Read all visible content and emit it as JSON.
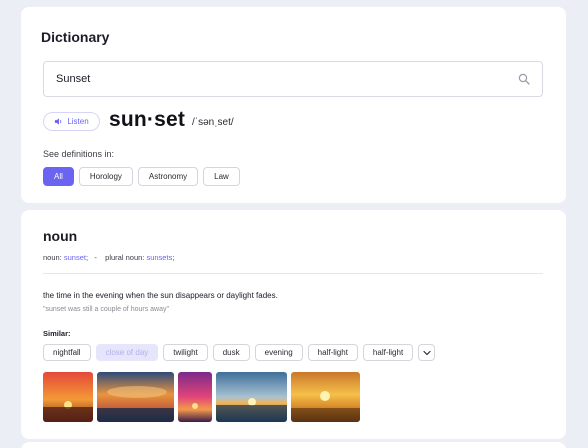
{
  "app": {
    "title": "Dictionary"
  },
  "search": {
    "value": "Sunset"
  },
  "entry": {
    "listen_label": "Listen",
    "headword": "sun·set",
    "phonetic": "/ˈsənˌset/"
  },
  "definitions_in": {
    "label": "See definitions in:",
    "options": [
      "All",
      "Horology",
      "Astronomy",
      "Law"
    ],
    "selected": "All"
  },
  "noun": {
    "part_of_speech": "noun",
    "form1_label": "noun:",
    "form1_word": "sunset",
    "separator": ";   -   ",
    "form2_label": "plural noun:",
    "form2_word": "sunsets",
    "trailing": ";",
    "definition": "the time in the evening when the sun disappears or daylight fades.",
    "example": "\"sunset was still a couple of hours away\"",
    "similar_label": "Similar:",
    "similar": [
      "nightfall",
      "close of day",
      "twilight",
      "dusk",
      "evening",
      "half-light",
      "half-light"
    ],
    "similar_muted_index": 1
  },
  "colors": {
    "accent": "#6a64f1",
    "background": "#eceef5"
  },
  "icons": {
    "search": "search-icon",
    "listen": "speaker-icon",
    "expand": "chevron-down-icon"
  }
}
